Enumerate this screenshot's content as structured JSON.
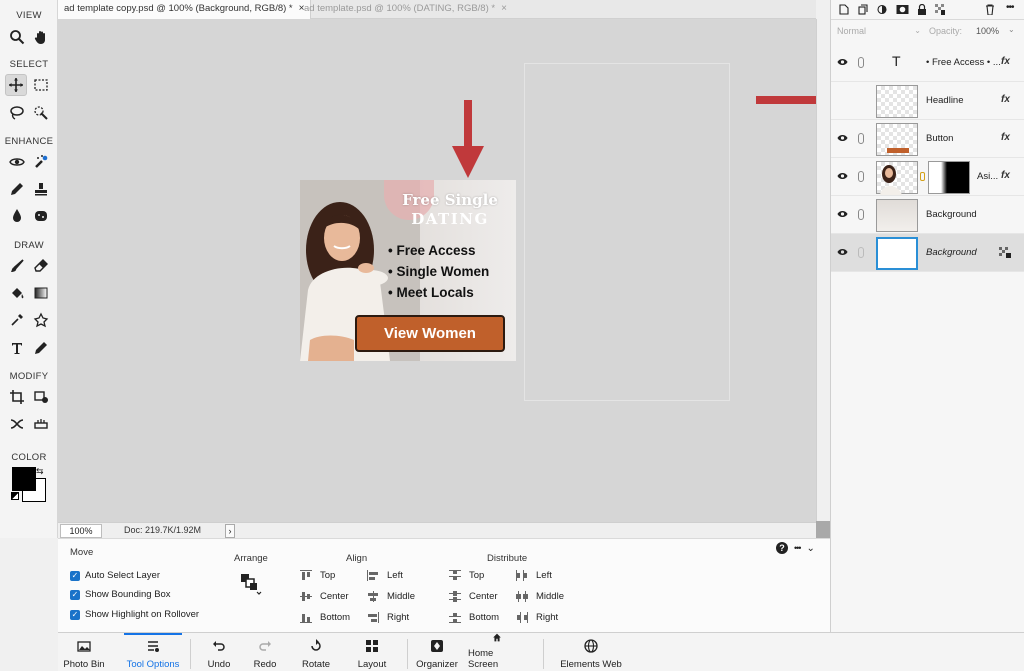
{
  "toolbar": {
    "sections": {
      "view": "VIEW",
      "select": "SELECT",
      "enhance": "ENHANCE",
      "draw": "DRAW",
      "modify": "MODIFY",
      "color": "COLOR"
    },
    "foreground_color": "#000000",
    "background_color": "#ffffff"
  },
  "tabs": [
    {
      "label": "ad template copy.psd @ 100% (Background, RGB/8) *",
      "active": true
    },
    {
      "label": "ad template.psd @ 100% (DATING, RGB/8) *",
      "active": false
    }
  ],
  "canvas": {
    "ad": {
      "headline": "Free Single",
      "subheadline": "DATING",
      "bullets": [
        "Free Access",
        "Single Women",
        "Meet Locals"
      ],
      "button": "View Women"
    },
    "arrow_color": "#c0393b"
  },
  "status": {
    "zoom": "100%",
    "doc_info": "Doc: 219.7K/1.92M",
    "arrow": "›"
  },
  "options": {
    "move_title": "Move",
    "checkboxes": [
      "Auto Select Layer",
      "Show Bounding Box",
      "Show Highlight on Rollover"
    ],
    "arrange_title": "Arrange",
    "align_title": "Align",
    "align_col1": [
      "Top",
      "Center",
      "Bottom"
    ],
    "align_col2": [
      "Left",
      "Middle",
      "Right"
    ],
    "distribute_title": "Distribute",
    "distribute_col1": [
      "Top",
      "Center",
      "Bottom"
    ],
    "distribute_col2": [
      "Left",
      "Middle",
      "Right"
    ],
    "more": "•••"
  },
  "bottom_bar": [
    {
      "label": "Photo Bin",
      "icon": "photo-bin-icon"
    },
    {
      "label": "Tool Options",
      "icon": "tool-options-icon",
      "active": true
    },
    {
      "label": "Undo",
      "icon": "undo-icon"
    },
    {
      "label": "Redo",
      "icon": "redo-icon"
    },
    {
      "label": "Rotate",
      "icon": "rotate-icon"
    },
    {
      "label": "Layout",
      "icon": "layout-icon"
    },
    {
      "label": "Organizer",
      "icon": "organizer-icon"
    },
    {
      "label": "Home Screen",
      "icon": "home-icon"
    },
    {
      "label": "Elements Web",
      "icon": "globe-icon"
    }
  ],
  "layers_panel": {
    "blend_mode": "Normal",
    "opacity_label": "Opacity:",
    "opacity_value": "100%",
    "layers": [
      {
        "name": "• Free Access • ...",
        "type": "text",
        "fx": "fx"
      },
      {
        "name": "Headline",
        "type": "pixel",
        "fx": "fx"
      },
      {
        "name": "Button",
        "type": "pixel",
        "fx": "fx"
      },
      {
        "name": "Asi...",
        "type": "masked",
        "fx": "fx"
      },
      {
        "name": "Background",
        "type": "pixel",
        "fx": ""
      },
      {
        "name": "Background",
        "type": "background",
        "fx": "",
        "selected": true
      }
    ]
  }
}
